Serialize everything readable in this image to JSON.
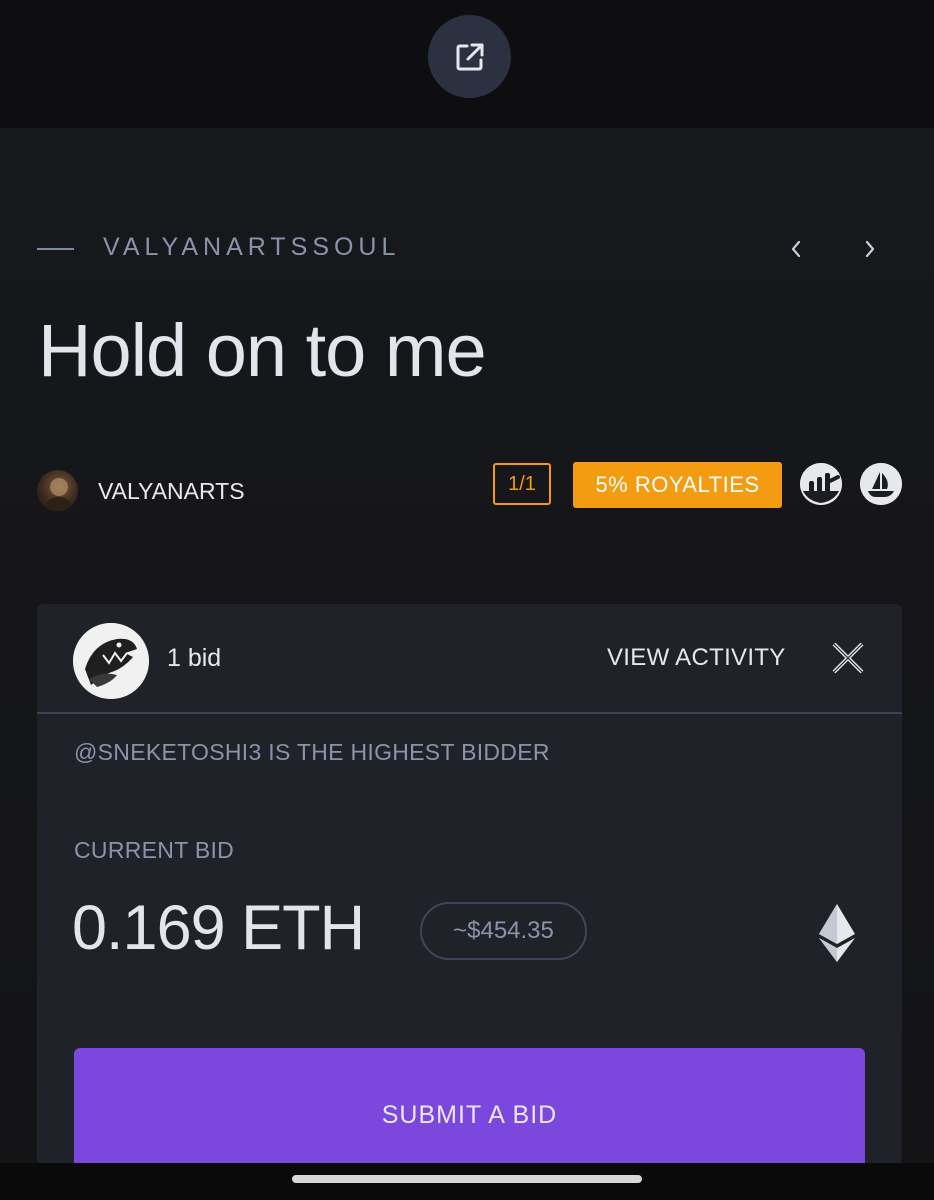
{
  "header": {
    "open_external_icon": "external-link-icon"
  },
  "collection": {
    "name": "VALYANARTSSOUL",
    "prev_icon": "chevron-left-icon",
    "next_icon": "chevron-right-icon"
  },
  "artwork": {
    "title": "Hold on to me"
  },
  "artist": {
    "name": "VALYANARTS",
    "avatar_icon": "artist-avatar"
  },
  "badges": {
    "edition": "1/1",
    "royalties": "5% ROYALTIES",
    "analytics_icon": "chart-icon",
    "opensea_icon": "opensea-icon",
    "royalties_color": "#f39c12"
  },
  "auction": {
    "bid_count": "1 bid",
    "view_activity": "VIEW ACTIVITY",
    "close_icon": "close-icon",
    "highest_bidder": "@SNEKETOSHI3 IS THE HIGHEST BIDDER",
    "current_bid_label": "CURRENT BID",
    "current_bid": "0.169 ETH",
    "usd_value": "~$454.35",
    "currency_icon": "ethereum-icon",
    "submit_label": "SUBMIT A BID",
    "submit_color": "#7c47dd"
  }
}
